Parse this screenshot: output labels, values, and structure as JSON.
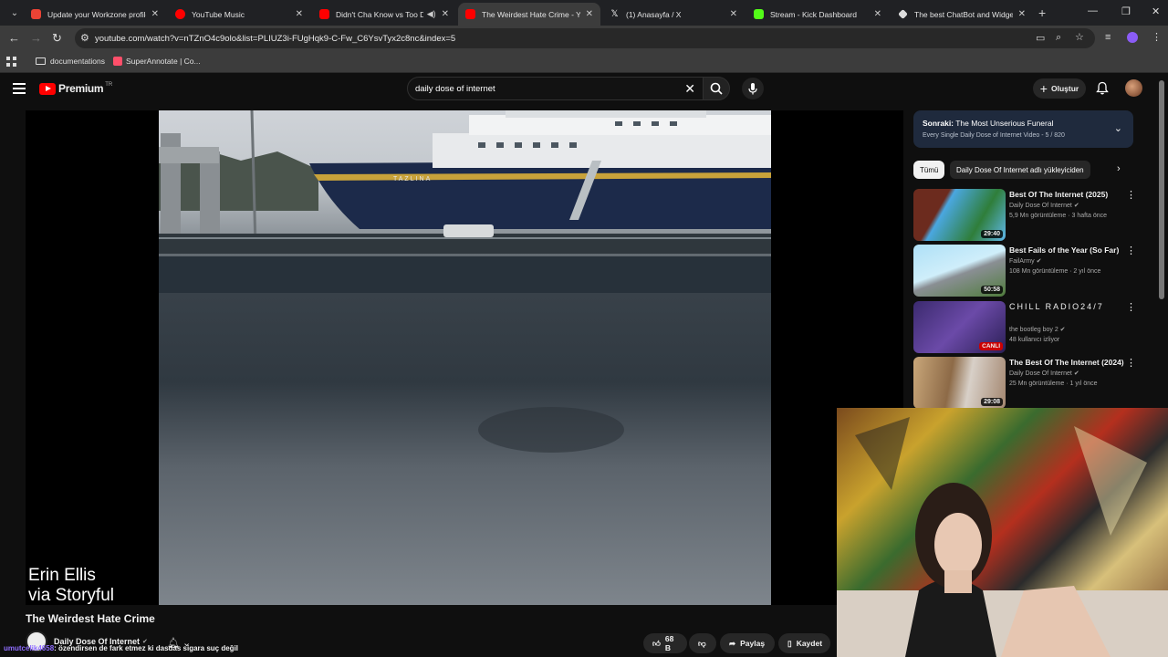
{
  "browser": {
    "tabs": [
      {
        "title": "Update your Workzone profile",
        "favicon_color": "#ea4335",
        "active": false
      },
      {
        "title": "YouTube Music",
        "favicon_color": "#ff0000",
        "active": false
      },
      {
        "title": "Didn't Cha Know vs Too De",
        "favicon_color": "#ff0000",
        "active": false
      },
      {
        "title": "The Weirdest Hate Crime - You",
        "favicon_color": "#ff0000",
        "active": true
      },
      {
        "title": "(1) Anasayfa / X",
        "favicon_color": "#ffffff",
        "active": false
      },
      {
        "title": "Stream - Kick Dashboard",
        "favicon_color": "#53fc18",
        "active": false
      },
      {
        "title": "The best ChatBot and Widgets",
        "favicon_color": "#dddddd",
        "active": false
      }
    ],
    "url": "youtube.com/watch?v=nTZnO4c9olo&list=PLIUZ3i-FUgHqk9-C-Fw_C6YsvTyx2c8nc&index=5",
    "bookmarks": [
      {
        "label": "documentations"
      },
      {
        "label": "SuperAnnotate | Co..."
      }
    ]
  },
  "youtube": {
    "logo": "Premium",
    "logo_region": "TR",
    "search_query": "daily dose of internet",
    "create_label": "Oluştur",
    "video": {
      "title": "The Weirdest Hate Crime",
      "credit_line1": "Erin Ellis",
      "credit_line2": "via Storyful",
      "channel": "Daily Dose Of Internet",
      "likes": "68 B",
      "share_label": "Paylaş",
      "save_label": "Kaydet",
      "ship_name": "TAZLINA"
    },
    "up_next": {
      "prefix": "Sonraki:",
      "title": "The Most Unserious Funeral",
      "subtitle": "Every Single Daily Dose of Internet Video - 5 / 820"
    },
    "chips": [
      {
        "label": "Tümü",
        "selected": true
      },
      {
        "label": "Daily Dose Of Internet adlı yükleyiciden",
        "selected": false
      }
    ],
    "recommendations": [
      {
        "title": "Best Of The Internet (2025)",
        "channel": "Daily Dose Of Internet",
        "meta": "5,9 Mn görüntüleme · 3 hafta önce",
        "duration": "29:40",
        "verified": true
      },
      {
        "title": "Best Fails of the Year (So Far)",
        "channel": "FailArmy",
        "meta": "108 Mn görüntüleme · 2 yıl önce",
        "duration": "50:58",
        "verified": true
      },
      {
        "title": "CHILL RADIO24/7",
        "channel": "the bootleg boy 2",
        "meta": "48 kullanıcı izliyor",
        "badge": "CANLI",
        "verified": true
      },
      {
        "title": "The Best Of The Internet (2024)",
        "channel": "Daily Dose Of Internet",
        "meta": "25 Mn görüntüleme · 1 yıl önce",
        "duration": "29:08",
        "verified": true
      }
    ]
  },
  "chat": {
    "user": "umutcelik4658",
    "message": "özendirsen de fark etmez ki dasdas sigara suç değil"
  }
}
